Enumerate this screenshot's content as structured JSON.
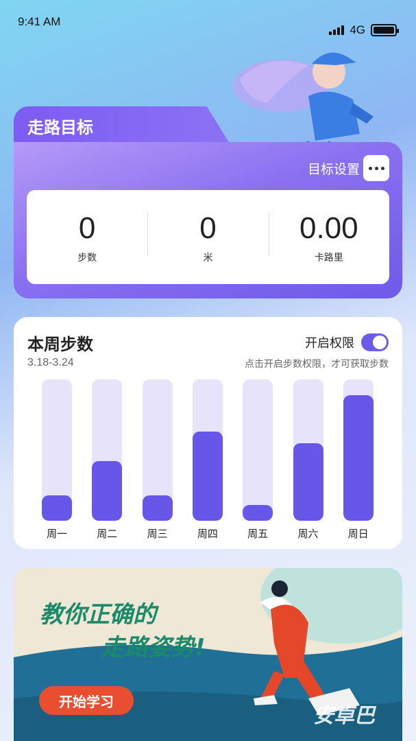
{
  "status_bar": {
    "time": "9:41 AM",
    "network": "4G"
  },
  "goal": {
    "title": "走路目标",
    "settings_label": "目标设置",
    "stats": [
      {
        "value": "0",
        "label": "步数"
      },
      {
        "value": "0",
        "label": "米"
      },
      {
        "value": "0.00",
        "label": "卡路里"
      }
    ]
  },
  "week": {
    "title": "本周步数",
    "range": "3.18-3.24",
    "permission_label": "开启权限",
    "permission_hint": "点击开启步数权限，才可获取步数",
    "permission_on": true
  },
  "chart_data": {
    "type": "bar",
    "categories": [
      "周一",
      "周二",
      "周三",
      "周四",
      "周五",
      "周六",
      "周日"
    ],
    "values": [
      18,
      42,
      18,
      63,
      11,
      55,
      89
    ],
    "ylim": [
      0,
      100
    ],
    "colors": {
      "fill": "#6756e8",
      "track": "#e6e3fb"
    }
  },
  "banner": {
    "line1": "教你正确的",
    "line2": "走路姿势!",
    "button": "开始学习",
    "watermark": "安卓巴"
  }
}
